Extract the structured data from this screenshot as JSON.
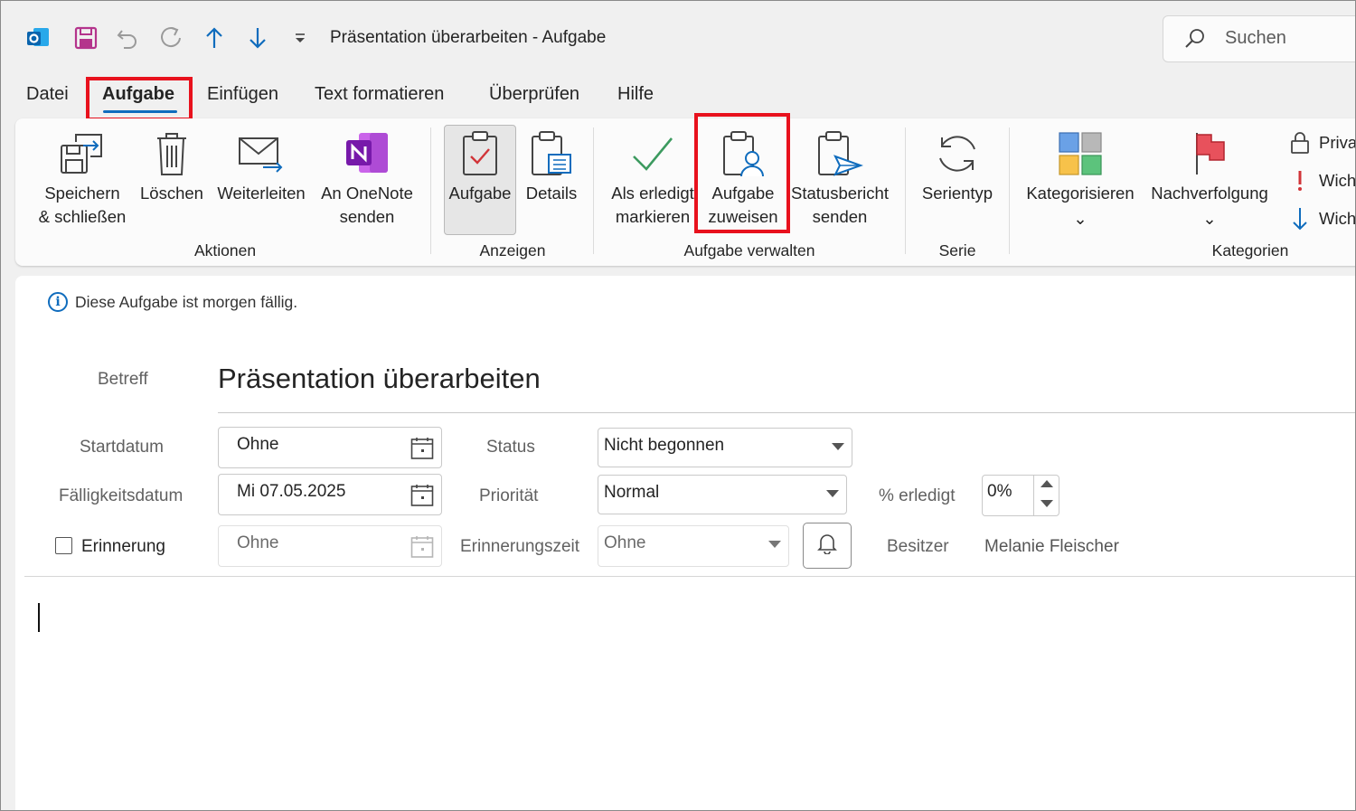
{
  "window": {
    "title": "Präsentation überarbeiten  -  Aufgabe",
    "search_placeholder": "Suchen"
  },
  "quick_access": {
    "icons": [
      "outlook-logo-icon",
      "save-icon",
      "undo-icon",
      "redo-icon",
      "up-arrow-icon",
      "down-arrow-icon",
      "customize-dropdown-icon"
    ]
  },
  "menu": {
    "tabs": [
      "Datei",
      "Aufgabe",
      "Einfügen",
      "Text formatieren",
      "Überprüfen",
      "Hilfe"
    ],
    "active": "Aufgabe"
  },
  "ribbon": {
    "groups": {
      "aktionen": {
        "label": "Aktionen",
        "buttons": [
          {
            "line1": "Speichern",
            "line2": "& schließen"
          },
          {
            "line1": "Löschen",
            "line2": ""
          },
          {
            "line1": "Weiterleiten",
            "line2": ""
          },
          {
            "line1": "An OneNote",
            "line2": "senden"
          }
        ]
      },
      "anzeigen": {
        "label": "Anzeigen",
        "buttons": [
          {
            "line1": "Aufgabe",
            "line2": ""
          },
          {
            "line1": "Details",
            "line2": ""
          }
        ]
      },
      "verwalten": {
        "label": "Aufgabe verwalten",
        "buttons": [
          {
            "line1": "Als erledigt",
            "line2": "markieren"
          },
          {
            "line1": "Aufgabe",
            "line2": "zuweisen"
          },
          {
            "line1": "Statusbericht",
            "line2": "senden"
          }
        ]
      },
      "serie": {
        "label": "Serie",
        "buttons": [
          {
            "line1": "Serientyp",
            "line2": ""
          }
        ]
      },
      "kategorien": {
        "label": "Kategorien",
        "buttons": [
          {
            "line1": "Kategorisieren",
            "line2": "⌄"
          },
          {
            "line1": "Nachverfolgung",
            "line2": "⌄"
          }
        ],
        "small": [
          "Priva",
          "Wich",
          "Wich"
        ]
      }
    }
  },
  "task": {
    "info": "Diese Aufgabe ist morgen fällig.",
    "subject_label": "Betreff",
    "subject": "Präsentation überarbeiten",
    "start_label": "Startdatum",
    "start_value": "Ohne",
    "due_label": "Fälligkeitsdatum",
    "due_value": "Mi 07.05.2025",
    "reminder_label": "Erinnerung",
    "reminder_date": "Ohne",
    "status_label": "Status",
    "status_value": "Nicht begonnen",
    "priority_label": "Priorität",
    "priority_value": "Normal",
    "reminder_time_label": "Erinnerungszeit",
    "reminder_time_value": "Ohne",
    "percent_label": "% erledigt",
    "percent_value": "0%",
    "owner_label": "Besitzer",
    "owner_value": "Melanie Fleischer"
  },
  "highlight_color": "#e8111d",
  "accent_color": "#0f6cbd"
}
